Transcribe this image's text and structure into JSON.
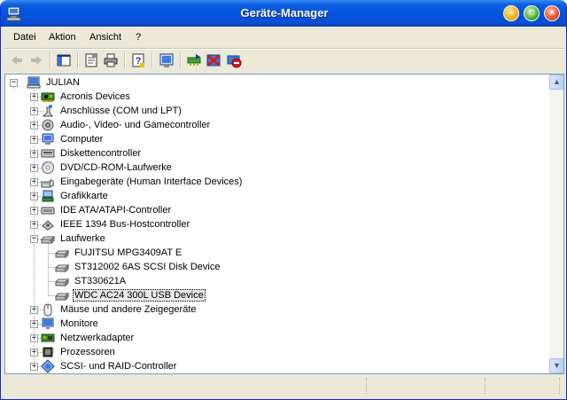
{
  "window": {
    "title": "Geräte-Manager",
    "controls": {
      "minimize": "–",
      "maximize": "□",
      "close": "×"
    }
  },
  "menu": [
    {
      "label": "Datei"
    },
    {
      "label": "Aktion"
    },
    {
      "label": "Ansicht"
    },
    {
      "label": "?"
    }
  ],
  "toolbar": [
    {
      "name": "back-button",
      "icon": "arrow-left-icon",
      "enabled": false
    },
    {
      "name": "forward-button",
      "icon": "arrow-right-icon",
      "enabled": false
    },
    {
      "name": "show-hide-console-tree-button",
      "icon": "console-tree-icon",
      "enabled": true
    },
    {
      "name": "properties-button",
      "icon": "properties-icon",
      "enabled": true
    },
    {
      "name": "print-button",
      "icon": "printer-icon",
      "enabled": true
    },
    {
      "name": "help-button",
      "icon": "help-icon",
      "enabled": true
    },
    {
      "name": "scan-hardware-button",
      "icon": "scan-hardware-icon",
      "enabled": true
    },
    {
      "name": "update-driver-button",
      "icon": "update-driver-icon",
      "enabled": true
    },
    {
      "name": "uninstall-button",
      "icon": "uninstall-icon",
      "enabled": true
    },
    {
      "name": "disable-button",
      "icon": "disable-icon",
      "enabled": true
    }
  ],
  "tree": {
    "root": {
      "label": "JULIAN",
      "icon": "computer-icon",
      "expanded": true
    },
    "categories": [
      {
        "label": "Acronis Devices",
        "icon": "chip-board-icon",
        "expanded": false
      },
      {
        "label": "Anschlüsse (COM und LPT)",
        "icon": "port-connector-icon",
        "expanded": false
      },
      {
        "label": "Audio-, Video- und Gamecontroller",
        "icon": "speaker-icon",
        "expanded": false
      },
      {
        "label": "Computer",
        "icon": "computer-tower-icon",
        "expanded": false
      },
      {
        "label": "Diskettencontroller",
        "icon": "floppy-controller-icon",
        "expanded": false
      },
      {
        "label": "DVD/CD-ROM-Laufwerke",
        "icon": "cd-drive-icon",
        "expanded": false
      },
      {
        "label": "Eingabegeräte (Human Interface Devices)",
        "icon": "hid-icon",
        "expanded": false
      },
      {
        "label": "Grafikkarte",
        "icon": "display-adapter-icon",
        "expanded": false
      },
      {
        "label": "IDE ATA/ATAPI-Controller",
        "icon": "ide-controller-icon",
        "expanded": false
      },
      {
        "label": "IEEE 1394 Bus-Hostcontroller",
        "icon": "firewire-icon",
        "expanded": false
      },
      {
        "label": "Laufwerke",
        "icon": "disk-drive-icon",
        "expanded": true,
        "children": [
          {
            "label": "FUJITSU MPG3409AT  E",
            "icon": "disk-drive-icon"
          },
          {
            "label": "ST312002 6AS SCSI Disk Device",
            "icon": "disk-drive-icon"
          },
          {
            "label": "ST330621A",
            "icon": "disk-drive-icon"
          },
          {
            "label": "WDC AC24 300L USB Device",
            "icon": "disk-drive-icon",
            "selected": true
          }
        ]
      },
      {
        "label": "Mäuse und andere Zeigegeräte",
        "icon": "mouse-icon",
        "expanded": false
      },
      {
        "label": "Monitore",
        "icon": "monitor-icon",
        "expanded": false
      },
      {
        "label": "Netzwerkadapter",
        "icon": "network-adapter-icon",
        "expanded": false
      },
      {
        "label": "Prozessoren",
        "icon": "processor-icon",
        "expanded": false
      },
      {
        "label": "SCSI- und RAID-Controller",
        "icon": "scsi-controller-icon",
        "expanded": false
      }
    ]
  },
  "scrollbar": {
    "up": "▲",
    "down": "▼"
  },
  "colors": {
    "titlebar": "#0452dd",
    "chrome": "#ece9d8",
    "tree_border": "#7f9db9"
  }
}
